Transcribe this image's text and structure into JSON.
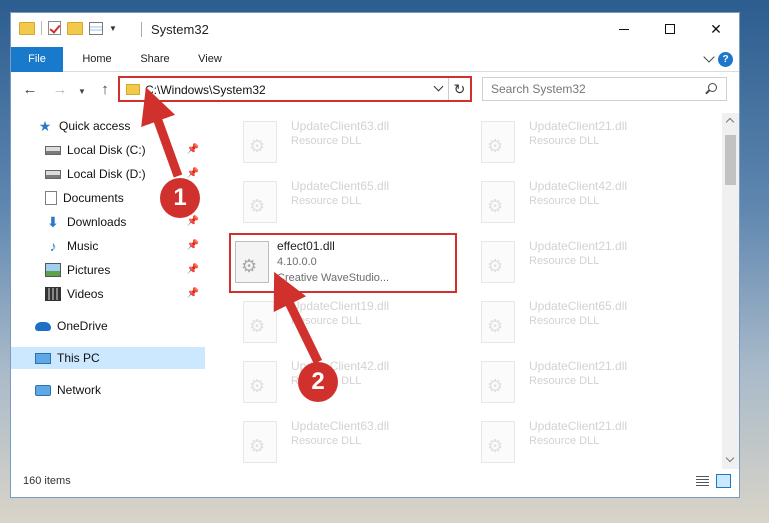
{
  "window": {
    "title": "System32",
    "minimize_glyph": "",
    "close_glyph": "✕"
  },
  "ribbon": {
    "tabs": [
      "File",
      "Home",
      "Share",
      "View"
    ],
    "help": "?"
  },
  "navbar": {
    "back_glyph": "←",
    "forward_glyph": "→",
    "recent_glyph": "▼",
    "up_glyph": "↑",
    "address": "C:\\Windows\\System32",
    "refresh_glyph": "↻",
    "search_placeholder": "Search System32"
  },
  "sidebar": {
    "items": [
      {
        "label": "Quick access",
        "icon": "quick-access-star-icon"
      },
      {
        "label": "Local Disk (C:)",
        "icon": "drive-icon",
        "pinned": true
      },
      {
        "label": "Local Disk (D:)",
        "icon": "drive-icon",
        "pinned": true
      },
      {
        "label": "Documents",
        "icon": "documents-icon",
        "pinned": true
      },
      {
        "label": "Downloads",
        "icon": "download-arrow-icon",
        "pinned": true
      },
      {
        "label": "Music",
        "icon": "music-note-icon",
        "pinned": true
      },
      {
        "label": "Pictures",
        "icon": "pictures-icon",
        "pinned": true
      },
      {
        "label": "Videos",
        "icon": "video-icon",
        "pinned": true
      },
      {
        "label": "OneDrive",
        "icon": "cloud-icon"
      },
      {
        "label": "This PC",
        "icon": "computer-icon",
        "selected": true
      },
      {
        "label": "Network",
        "icon": "network-icon"
      }
    ],
    "pin_glyph": "📌",
    "star_glyph": "★",
    "download_glyph": "⬇",
    "music_glyph": "♪"
  },
  "files": {
    "left_column": [
      {
        "name": "UpdateClient63.dll",
        "desc": "Resource DLL"
      },
      {
        "name": "UpdateClient65.dll",
        "desc": "Resource DLL"
      },
      {
        "name": "effect01.dll",
        "version": "4.10.0.0",
        "desc": "Creative WaveStudio...",
        "highlighted": true
      },
      {
        "name": "UpdateClient19.dll",
        "desc": "Resource DLL"
      },
      {
        "name": "UpdateClient42.dll",
        "desc": "Resource DLL"
      },
      {
        "name": "UpdateClient63.dll",
        "desc": "Resource DLL"
      }
    ],
    "right_column": [
      {
        "name": "UpdateClient21.dll",
        "desc": "Resource DLL"
      },
      {
        "name": "UpdateClient42.dll",
        "desc": "Resource DLL"
      },
      {
        "name": "UpdateClient21.dll",
        "desc": "Resource DLL"
      },
      {
        "name": "UpdateClient65.dll",
        "desc": "Resource DLL"
      },
      {
        "name": "UpdateClient21.dll",
        "desc": "Resource DLL"
      },
      {
        "name": "UpdateClient21.dll",
        "desc": "Resource DLL"
      }
    ]
  },
  "status": {
    "item_count": "160 items"
  },
  "annotations": {
    "step1": "1",
    "step2": "2",
    "highlight_color": "#d0312d"
  }
}
